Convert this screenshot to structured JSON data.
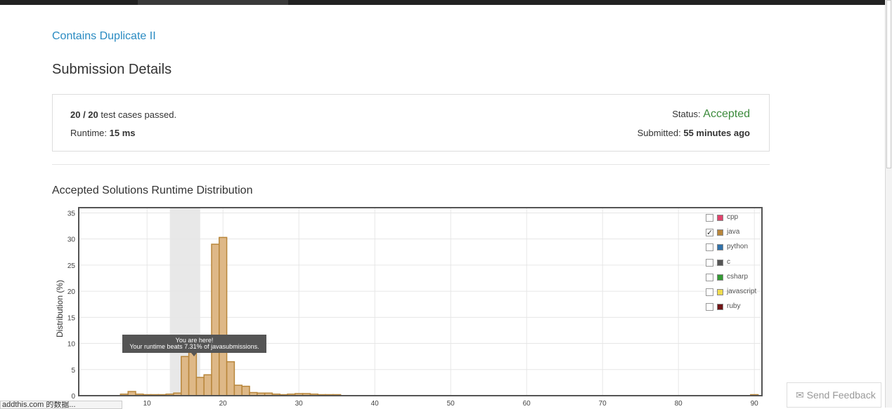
{
  "problem": {
    "title": "Contains Duplicate II"
  },
  "page": {
    "heading": "Submission Details"
  },
  "summary": {
    "passed": "20 / 20",
    "passed_suffix": "test cases passed.",
    "runtime_label": "Runtime:",
    "runtime_value": "15 ms",
    "status_label": "Status:",
    "status_value": "Accepted",
    "submitted_label": "Submitted:",
    "submitted_value": "55 minutes ago"
  },
  "colors": {
    "accepted": "#3c8b3c",
    "link": "#2a8bc2",
    "java_bar_fill": "#deb887",
    "java_bar_stroke": "#b8863b"
  },
  "tooltip": {
    "line1": "You are here!",
    "line2": "Your runtime beats 7.31% of javasubmissions."
  },
  "feedback": {
    "icon": "envelope-icon",
    "label": "Send Feedback"
  },
  "status_bar": {
    "text": "addthis.com 的数据..."
  },
  "legend": [
    {
      "label": "cpp",
      "checked": false,
      "color": "#e0446c"
    },
    {
      "label": "java",
      "checked": true,
      "color": "#b8863b"
    },
    {
      "label": "python",
      "checked": false,
      "color": "#3071a9"
    },
    {
      "label": "c",
      "checked": false,
      "color": "#555555"
    },
    {
      "label": "csharp",
      "checked": false,
      "color": "#339933"
    },
    {
      "label": "javascript",
      "checked": false,
      "color": "#f0db4f"
    },
    {
      "label": "ruby",
      "checked": false,
      "color": "#701516"
    }
  ],
  "chart_data": {
    "type": "bar",
    "title": "Accepted Solutions Runtime Distribution",
    "xlabel": "",
    "ylabel": "Distribution (%)",
    "xlim": [
      1,
      91
    ],
    "ylim": [
      0,
      36
    ],
    "xticks": [
      10,
      20,
      30,
      40,
      50,
      60,
      70,
      80,
      90
    ],
    "yticks": [
      0,
      5,
      10,
      15,
      20,
      25,
      30,
      35
    ],
    "highlight_range": [
      13,
      17
    ],
    "series": [
      {
        "name": "java",
        "x": [
          7,
          8,
          9,
          10,
          11,
          12,
          13,
          14,
          15,
          16,
          17,
          18,
          19,
          20,
          21,
          22,
          23,
          24,
          25,
          26,
          27,
          28,
          29,
          30,
          31,
          32,
          33,
          34,
          35,
          90
        ],
        "values": [
          0.3,
          0.8,
          0.3,
          0.2,
          0.2,
          0.2,
          0.3,
          0.5,
          7.5,
          10,
          3.5,
          4,
          29,
          30.3,
          6.5,
          2,
          1.8,
          0.6,
          0.5,
          0.5,
          0.3,
          0.2,
          0.3,
          0.4,
          0.4,
          0.3,
          0.2,
          0.2,
          0.2,
          0.2
        ]
      }
    ]
  }
}
